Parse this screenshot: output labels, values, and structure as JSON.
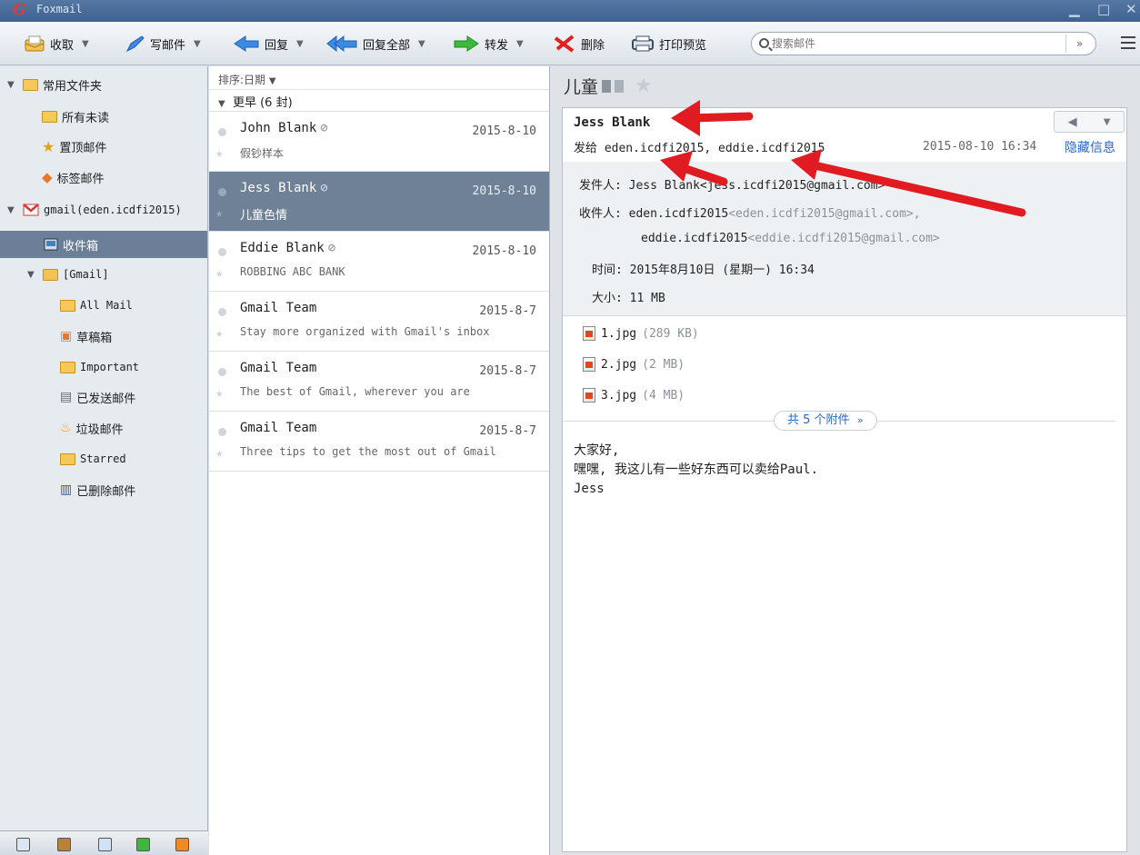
{
  "app": {
    "title": "Foxmail"
  },
  "toolbar": {
    "receive": "收取",
    "compose": "写邮件",
    "reply": "回复",
    "reply_all": "回复全部",
    "forward": "转发",
    "delete": "删除",
    "print_preview": "打印预览"
  },
  "search": {
    "placeholder": "搜索邮件"
  },
  "sidebar": {
    "common_folder": "常用文件夹",
    "unread": "所有未读",
    "pinned": "置顶邮件",
    "tagged": "标签邮件",
    "account": "gmail(eden.icdfi2015)",
    "inbox": "收件箱",
    "gmail_group": "[Gmail]",
    "all_mail": "All Mail",
    "drafts": "草稿箱",
    "important": "Important",
    "sent": "已发送邮件",
    "spam": "垃圾邮件",
    "starred": "Starred",
    "trash": "已删除邮件"
  },
  "list": {
    "sort_label": "排序:日期",
    "group_label": "更早 (6 封)",
    "messages": [
      {
        "sender": "John Blank",
        "date": "2015-8-10",
        "subject": "假钞样本",
        "attachment": true
      },
      {
        "sender": "Jess Blank",
        "date": "2015-8-10",
        "subject": "儿童色情",
        "attachment": true
      },
      {
        "sender": "Eddie Blank",
        "date": "2015-8-10",
        "subject": "ROBBING ABC BANK",
        "attachment": true
      },
      {
        "sender": "Gmail Team",
        "date": "2015-8-7",
        "subject": "Stay more organized with Gmail's inbox",
        "attachment": false
      },
      {
        "sender": "Gmail Team",
        "date": "2015-8-7",
        "subject": "The best of Gmail, wherever you are",
        "attachment": false
      },
      {
        "sender": "Gmail Team",
        "date": "2015-8-7",
        "subject": "Three tips to get the most out of Gmail",
        "attachment": false
      }
    ]
  },
  "reader": {
    "subject": "儿童",
    "from_name": "Jess Blank",
    "to_line": "发给 eden.icdfi2015, eddie.icdfi2015",
    "datetime": "2015-08-10 16:34",
    "hide_info": "隐藏信息",
    "details": {
      "sender_label": "发件人:",
      "sender_value": "Jess Blank<jess.icdfi2015@gmail.com>",
      "recipient_label": "收件人:",
      "recipient1_name": "eden.icdfi2015",
      "recipient1_addr": "<eden.icdfi2015@gmail.com>,",
      "recipient2_name": "eddie.icdfi2015",
      "recipient2_addr": "<eddie.icdfi2015@gmail.com>",
      "time_label": "时间:",
      "time_value": "2015年8月10日 (星期一) 16:34",
      "size_label": "大小:",
      "size_value": "11 MB"
    },
    "attachments": [
      {
        "name": "1.jpg",
        "size": "(289 KB)"
      },
      {
        "name": "2.jpg",
        "size": "(2 MB)"
      },
      {
        "name": "3.jpg",
        "size": "(4 MB)"
      }
    ],
    "attachment_summary": "共 5 个附件",
    "body": [
      "大家好,",
      "嘿嘿, 我这儿有一些好东西可以卖给Paul.",
      "Jess"
    ]
  },
  "colors": {
    "accent": "#2a66c9",
    "selection": "#6f8196",
    "annotation_arrow": "#e11b22"
  }
}
